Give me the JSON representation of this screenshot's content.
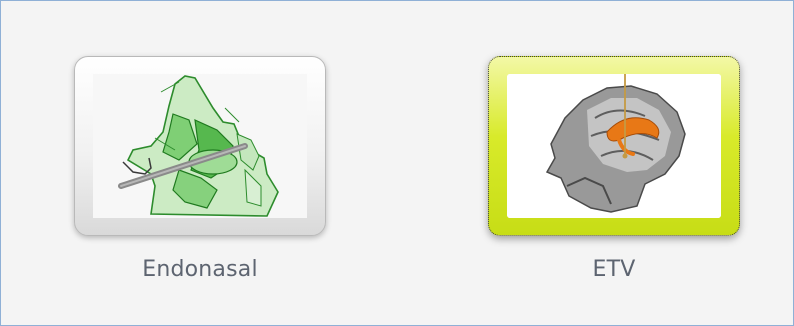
{
  "apps": [
    {
      "label": "Endonasal",
      "icon": "nasal-cavity-icon",
      "selected": false
    },
    {
      "label": "ETV",
      "icon": "brain-ventricle-icon",
      "selected": true
    }
  ],
  "colors": {
    "background": "#f4f4f4",
    "frame_border": "#8fb0d6",
    "selected_highlight": "#d8ea2a",
    "label_text": "#5d6470",
    "anatomy_green": "#2f8f2f",
    "ventricle_orange": "#e87816"
  }
}
